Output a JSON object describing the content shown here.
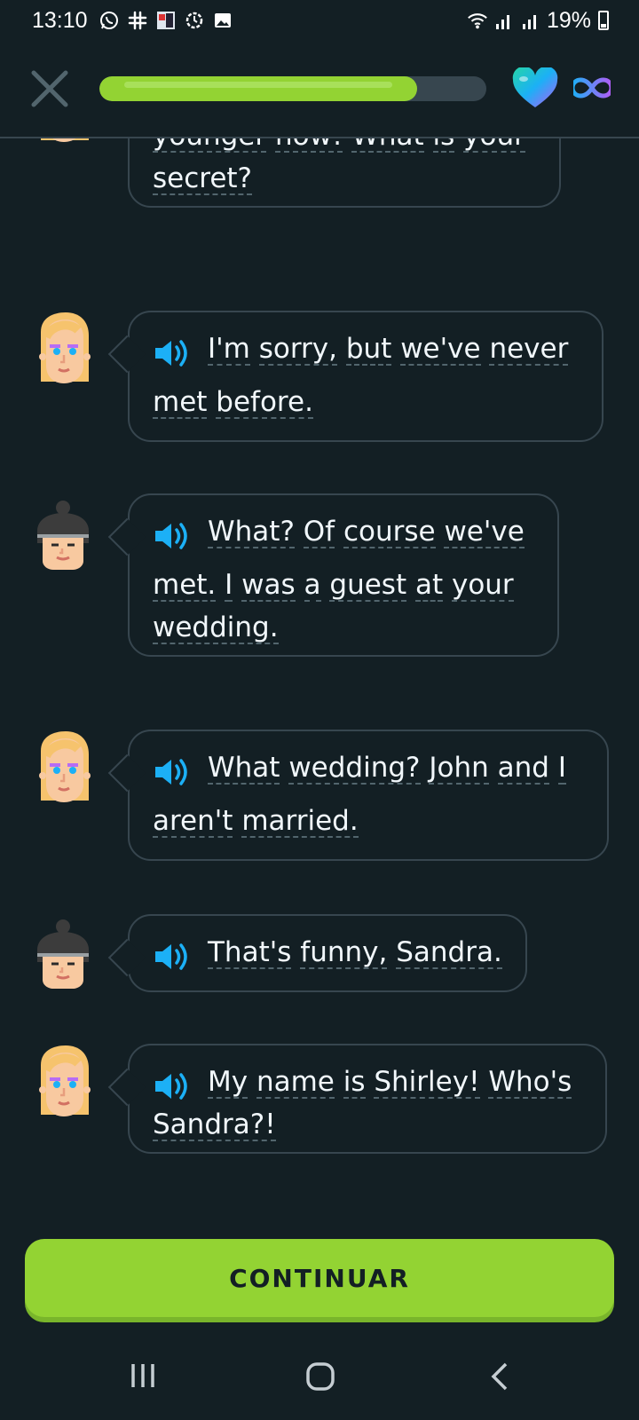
{
  "status_bar": {
    "time": "13:10",
    "battery": "19%"
  },
  "header": {
    "progress_fraction": 0.82,
    "lives": "infinity"
  },
  "messages": [
    {
      "speaker": "shirley",
      "lines": [
        [
          "younger",
          "now!",
          "What",
          "is",
          "your"
        ],
        [
          "secret?"
        ]
      ],
      "audio": false
    },
    {
      "speaker": "shirley",
      "lines": [
        [
          "I'm",
          "sorry,",
          "but",
          "we've",
          "never"
        ],
        [
          "met",
          "before."
        ]
      ],
      "audio": true
    },
    {
      "speaker": "friend",
      "lines": [
        [
          "What?",
          "Of",
          "course",
          "we've"
        ],
        [
          "met.",
          "I",
          "was",
          "a",
          "guest",
          "at",
          "your"
        ],
        [
          "wedding."
        ]
      ],
      "audio": true
    },
    {
      "speaker": "shirley",
      "lines": [
        [
          "What",
          "wedding?",
          "John",
          "and",
          "I"
        ],
        [
          "aren't",
          "married."
        ]
      ],
      "audio": true
    },
    {
      "speaker": "friend",
      "lines": [
        [
          "That's",
          "funny,",
          "Sandra."
        ]
      ],
      "audio": true
    },
    {
      "speaker": "shirley",
      "lines": [
        [
          "My",
          "name",
          "is",
          "Shirley!",
          "Who's"
        ],
        [
          "Sandra?!"
        ]
      ],
      "audio": true
    }
  ],
  "continue_label": "CONTINUAR",
  "colors": {
    "background": "#131f24",
    "accent_green": "#93d333",
    "speaker_blue": "#1cb0f6",
    "border": "#37464f"
  }
}
